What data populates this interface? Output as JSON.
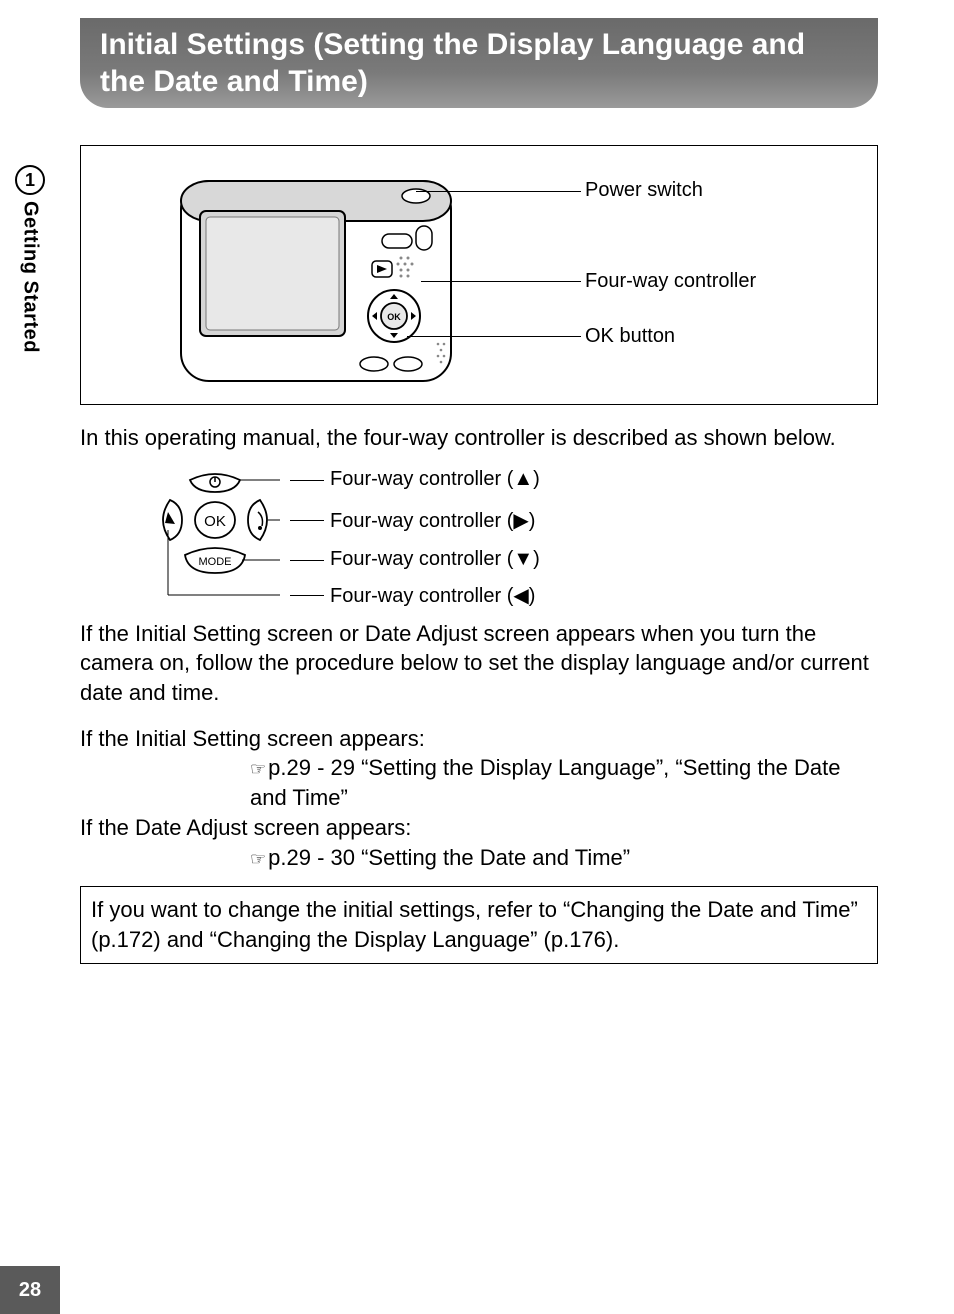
{
  "header": {
    "title": "Initial Settings (Setting the Display Language and the Date and Time)"
  },
  "side": {
    "chapter_number": "1",
    "chapter_label": "Getting Started"
  },
  "page_number": "28",
  "diagram": {
    "callouts": {
      "power": "Power switch",
      "fourway": "Four-way controller",
      "ok": "OK button"
    }
  },
  "intro_text": "In this operating manual, the four-way controller is described as shown below.",
  "controller": {
    "up": "Four-way controller (▲)",
    "right": "Four-way controller (▶)",
    "down": "Four-way controller (▼)",
    "left": "Four-way controller (◀)",
    "ok_label": "OK",
    "mode_label": "MODE"
  },
  "para_intro": "If the Initial Setting screen or Date Adjust screen appears when you turn the camera on, follow the procedure below to set the display language and/or current date and time.",
  "cond1_head": "If the Initial Setting screen appears:",
  "cond1_ref": "p.29 - 29 “Setting the Display Language”, “Setting the Date and Time”",
  "cond2_head": "If the Date Adjust screen appears:",
  "cond2_ref": "p.29 - 30 “Setting the Date and Time”",
  "note": "If you want to change the initial settings, refer to “Changing the Date and Time” (p.172) and “Changing the Display Language” (p.176)."
}
